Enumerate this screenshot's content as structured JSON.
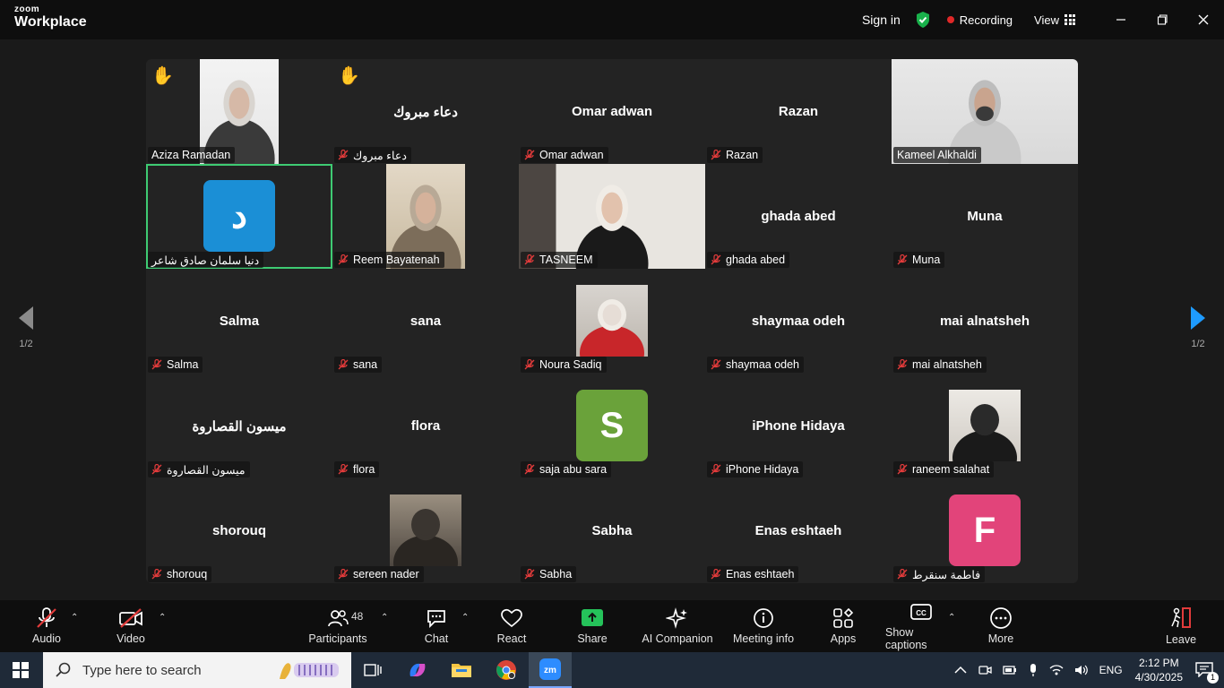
{
  "titlebar": {
    "brand_top": "zoom",
    "brand_bottom": "Workplace",
    "sign_in": "Sign in",
    "recording": "Recording",
    "view": "View"
  },
  "page_nav": {
    "left": "1/2",
    "right": "1/2"
  },
  "tiles": [
    {
      "label": "Aziza Ramadan",
      "type": "video",
      "hand": true,
      "muted": false
    },
    {
      "label": "دعاء مبروك",
      "center": "دعاء مبروك",
      "type": "name",
      "hand": true,
      "muted": true
    },
    {
      "label": "Omar adwan",
      "center": "Omar adwan",
      "type": "name",
      "muted": true
    },
    {
      "label": "Razan",
      "center": "Razan",
      "type": "name",
      "muted": true
    },
    {
      "label": "Kameel Alkhaldi",
      "type": "video",
      "muted": false
    },
    {
      "label": "دنيا سلمان صادق شاعر",
      "type": "avatar",
      "avatar_letter": "د",
      "avatar_color": "#1b8fd6",
      "muted": false,
      "active": true
    },
    {
      "label": "Reem Bayatenah",
      "type": "video",
      "muted": true
    },
    {
      "label": "TASNEEM",
      "type": "video",
      "muted": true
    },
    {
      "label": "ghada abed",
      "center": "ghada abed",
      "type": "name",
      "muted": true
    },
    {
      "label": "Muna",
      "center": "Muna",
      "type": "name",
      "muted": true
    },
    {
      "label": "Salma",
      "center": "Salma",
      "type": "name",
      "muted": true
    },
    {
      "label": "sana",
      "center": "sana",
      "type": "name",
      "muted": true
    },
    {
      "label": "Noura Sadiq",
      "type": "photo",
      "muted": true
    },
    {
      "label": "shaymaa odeh",
      "center": "shaymaa odeh",
      "type": "name",
      "muted": true
    },
    {
      "label": "mai alnatsheh",
      "center": "mai alnatsheh",
      "type": "name",
      "muted": true
    },
    {
      "label": "ميسون القصاروة",
      "center": "ميسون القصاروة",
      "type": "name",
      "muted": true
    },
    {
      "label": "flora",
      "center": "flora",
      "type": "name",
      "muted": true
    },
    {
      "label": "saja abu sara",
      "type": "avatar",
      "avatar_letter": "S",
      "avatar_color": "#6aa23a",
      "muted": true
    },
    {
      "label": "iPhone Hidaya",
      "center": "iPhone Hidaya",
      "type": "name",
      "muted": true
    },
    {
      "label": "raneem salahat",
      "type": "photo",
      "muted": true
    },
    {
      "label": "shorouq",
      "center": "shorouq",
      "type": "name",
      "muted": true
    },
    {
      "label": "sereen nader",
      "type": "photo",
      "muted": true
    },
    {
      "label": "Sabha",
      "center": "Sabha",
      "type": "name",
      "muted": true
    },
    {
      "label": "Enas eshtaeh",
      "center": "Enas eshtaeh",
      "type": "name",
      "muted": true
    },
    {
      "label": "فاطمة سنقرط",
      "type": "avatar",
      "avatar_letter": "F",
      "avatar_color": "#e2447a",
      "muted": true
    }
  ],
  "toolbar": {
    "audio": "Audio",
    "video": "Video",
    "participants": "Participants",
    "participants_count": "48",
    "chat": "Chat",
    "react": "React",
    "share": "Share",
    "ai_companion": "AI Companion",
    "meeting_info": "Meeting info",
    "apps": "Apps",
    "show_captions": "Show captions",
    "more": "More",
    "leave": "Leave",
    "share_color": "#25c25a",
    "leave_color": "#e23b3b"
  },
  "taskbar": {
    "search_placeholder": "Type here to search",
    "language": "ENG",
    "time": "2:12 PM",
    "date": "4/30/2025",
    "notification_count": "1"
  }
}
